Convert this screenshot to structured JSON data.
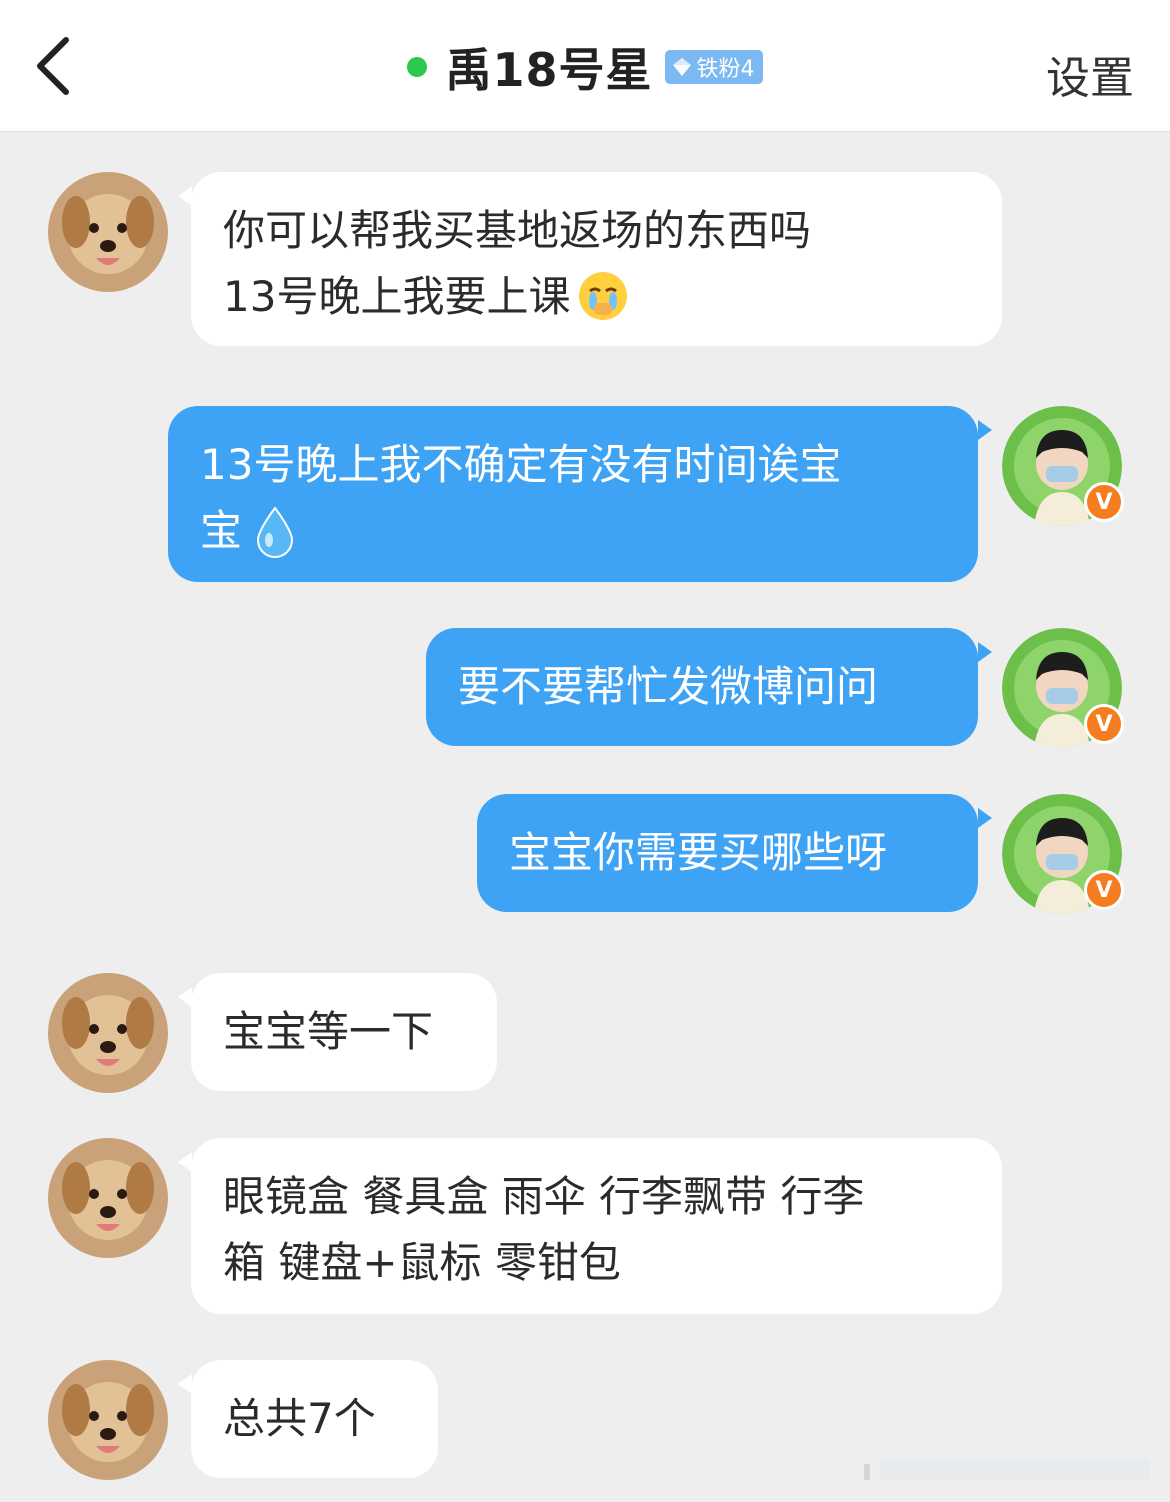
{
  "header": {
    "title": "禹18号星",
    "fan_badge": "铁粉4",
    "settings_label": "设置",
    "online_color": "#2dc84d",
    "badge_color": "#7cb8f2"
  },
  "colors": {
    "incoming_bubble": "#ffffff",
    "outgoing_bubble": "#3ea3f4",
    "verified_badge": "#f57c1f",
    "background": "#eeeeef"
  },
  "messages": [
    {
      "direction": "in",
      "text": "你可以帮我买基地返场的东西吗\n13号晚上我要上课",
      "emoji": "crying-emoji"
    },
    {
      "direction": "out",
      "text": "13号晚上我不确定有没有时间诶宝\n宝",
      "emoji": "droplet-emoji"
    },
    {
      "direction": "out",
      "text": "要不要帮忙发微博问问"
    },
    {
      "direction": "out",
      "text": "宝宝你需要买哪些呀"
    },
    {
      "direction": "in",
      "text": "宝宝等一下"
    },
    {
      "direction": "in",
      "text": "眼镜盒 餐具盒 雨伞 行李飘带 行李\n箱 键盘+鼠标 零钳包"
    },
    {
      "direction": "in",
      "text": "总共7个"
    }
  ],
  "self_avatar": {
    "verified_mark": "V"
  },
  "icons": {
    "back": "chevron-left-icon",
    "badge": "diamond-icon",
    "partner_avatar": "dog-avatar",
    "self_avatar": "user-avatar"
  }
}
